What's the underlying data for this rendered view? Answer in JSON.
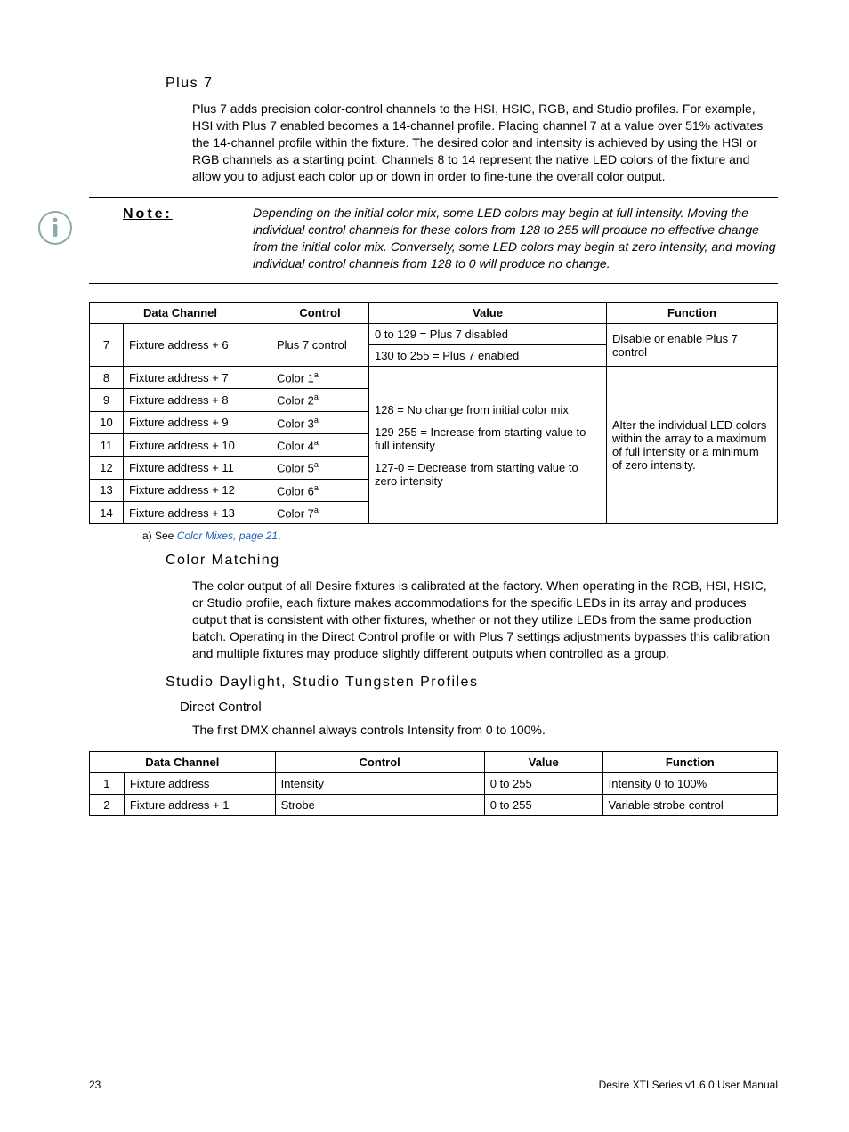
{
  "sections": {
    "plus7": {
      "title": "Plus 7",
      "body": "Plus 7 adds precision color-control channels to the HSI, HSIC, RGB, and Studio profiles. For example, HSI with Plus 7 enabled becomes a 14-channel profile. Placing channel 7 at a value over 51% activates the 14-channel profile within the fixture. The desired color and intensity is achieved by using the HSI or RGB channels as a starting point. Channels 8 to 14 represent the native LED colors of the fixture and allow you to adjust each color up or down in order to fine-tune the overall color output."
    },
    "note": {
      "label": "Note:",
      "text": "Depending on the initial color mix, some LED colors may begin at full intensity. Moving the individual control channels for these colors from 128 to 255 will produce no effective change from the initial color mix. Conversely, some LED colors may begin at zero intensity, and moving individual control channels from 128 to 0 will produce no change."
    },
    "table1": {
      "headers": {
        "data_channel": "Data Channel",
        "control": "Control",
        "value": "Value",
        "function": "Function"
      },
      "row7": {
        "idx": "7",
        "chan": "Fixture address + 6",
        "ctrl": "Plus 7 control",
        "val1": "0 to 129 = Plus 7 disabled",
        "val2": "130 to 255 = Plus 7 enabled",
        "fn": "Disable or enable Plus 7 control"
      },
      "rows": [
        {
          "idx": "8",
          "chan": "Fixture address + 7",
          "ctrl": "Color 1"
        },
        {
          "idx": "9",
          "chan": "Fixture address + 8",
          "ctrl": "Color 2"
        },
        {
          "idx": "10",
          "chan": "Fixture address + 9",
          "ctrl": "Color 3"
        },
        {
          "idx": "11",
          "chan": "Fixture address + 10",
          "ctrl": "Color 4"
        },
        {
          "idx": "12",
          "chan": "Fixture address + 11",
          "ctrl": "Color 5"
        },
        {
          "idx": "13",
          "chan": "Fixture address + 12",
          "ctrl": "Color 6"
        },
        {
          "idx": "14",
          "chan": "Fixture address + 13",
          "ctrl": "Color 7"
        }
      ],
      "shared_value_a": "128 = No change from initial color mix",
      "shared_value_b": "129-255 = Increase from starting value to full intensity",
      "shared_value_c": "127-0 = Decrease from starting value to zero intensity",
      "shared_fn": "Alter the individual LED colors within the array to a maximum of full intensity or a minimum of zero intensity.",
      "footnote_prefix": "a)   See ",
      "footnote_link": "Color Mixes, page 21",
      "footnote_suffix": "."
    },
    "color_matching": {
      "title": "Color Matching",
      "body": "The color output of all Desire fixtures is calibrated at the factory. When operating in the RGB, HSI, HSIC, or Studio profile, each fixture makes accommodations for the specific LEDs in its array and produces output that is consistent with other fixtures, whether or not they utilize LEDs from the same production batch. Operating in the Direct Control profile or with Plus 7 settings adjustments bypasses this calibration and multiple fixtures may produce slightly different outputs when controlled as a group."
    },
    "studio": {
      "title": "Studio Daylight, Studio Tungsten Profiles",
      "sub": "Direct Control",
      "body": "The first DMX channel always controls Intensity from 0 to 100%."
    },
    "table2": {
      "headers": {
        "data_channel": "Data Channel",
        "control": "Control",
        "value": "Value",
        "function": "Function"
      },
      "rows": [
        {
          "idx": "1",
          "chan": "Fixture address",
          "ctrl": "Intensity",
          "val": "0 to 255",
          "fn": "Intensity 0 to 100%"
        },
        {
          "idx": "2",
          "chan": "Fixture address + 1",
          "ctrl": "Strobe",
          "val": "0 to 255",
          "fn": "Variable strobe control"
        }
      ]
    }
  },
  "footer": {
    "page": "23",
    "doc": "Desire XTI Series v1.6.0 User Manual"
  },
  "sup_a": "a"
}
